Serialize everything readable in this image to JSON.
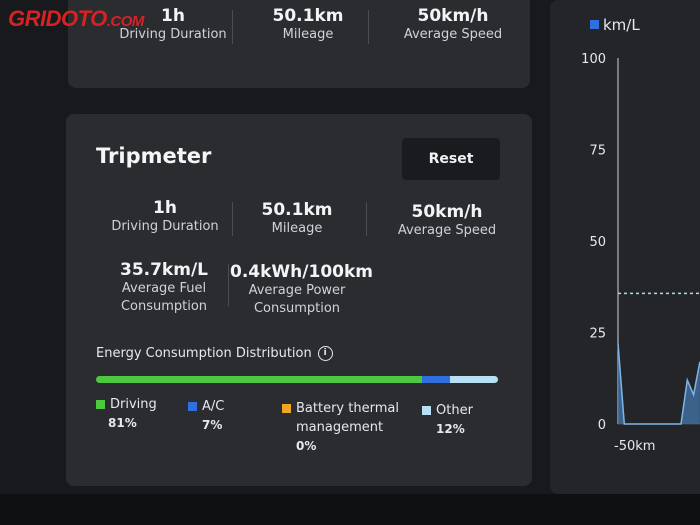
{
  "watermark": "GRIDOTO",
  "watermark_suffix": ".COM",
  "top_card": {
    "stats": [
      {
        "value": "1h",
        "label": "Driving Duration"
      },
      {
        "value": "50.1km",
        "label": "Mileage"
      },
      {
        "value": "50km/h",
        "label": "Average Speed"
      }
    ]
  },
  "tripmeter": {
    "title": "Tripmeter",
    "reset_label": "Reset",
    "stats": [
      {
        "value": "1h",
        "label": "Driving Duration"
      },
      {
        "value": "50.1km",
        "label": "Mileage"
      },
      {
        "value": "50km/h",
        "label": "Average Speed"
      }
    ],
    "consumption": [
      {
        "value": "35.7km/L",
        "label_line1": "Average Fuel",
        "label_line2": "Consumption"
      },
      {
        "value": "0.4kWh/100km",
        "label_line1": "Average Power",
        "label_line2": "Consumption"
      }
    ],
    "distribution_title": "Energy Consumption Distribution",
    "distribution": [
      {
        "name": "Driving",
        "pct": "81%",
        "value": 81,
        "color": "#4cc93f"
      },
      {
        "name": "A/C",
        "pct": "7%",
        "value": 7,
        "color": "#2f6fe0"
      },
      {
        "name_line1": "Battery thermal",
        "name_line2": "management",
        "pct": "0%",
        "value": 0,
        "color": "#f0a623"
      },
      {
        "name": "Other",
        "pct": "12%",
        "value": 12,
        "color": "#b9dff2"
      }
    ]
  },
  "chart_data": {
    "type": "line",
    "legend": "km/L",
    "legend_color": "#2f6fe0",
    "y_ticks": [
      "100",
      "75",
      "50",
      "25",
      "0"
    ],
    "ylim": [
      0,
      100
    ],
    "x_tick": "-50km",
    "reference_value": 35.7,
    "series": [
      {
        "x": [
          -50,
          -49,
          -48,
          -47,
          -46,
          -45,
          -44,
          -43,
          -42,
          -41,
          -40,
          -39,
          -38,
          -37
        ],
        "values": [
          22,
          0,
          0,
          0,
          0,
          0,
          0,
          0,
          0,
          0,
          0,
          12,
          8,
          17
        ]
      }
    ]
  }
}
